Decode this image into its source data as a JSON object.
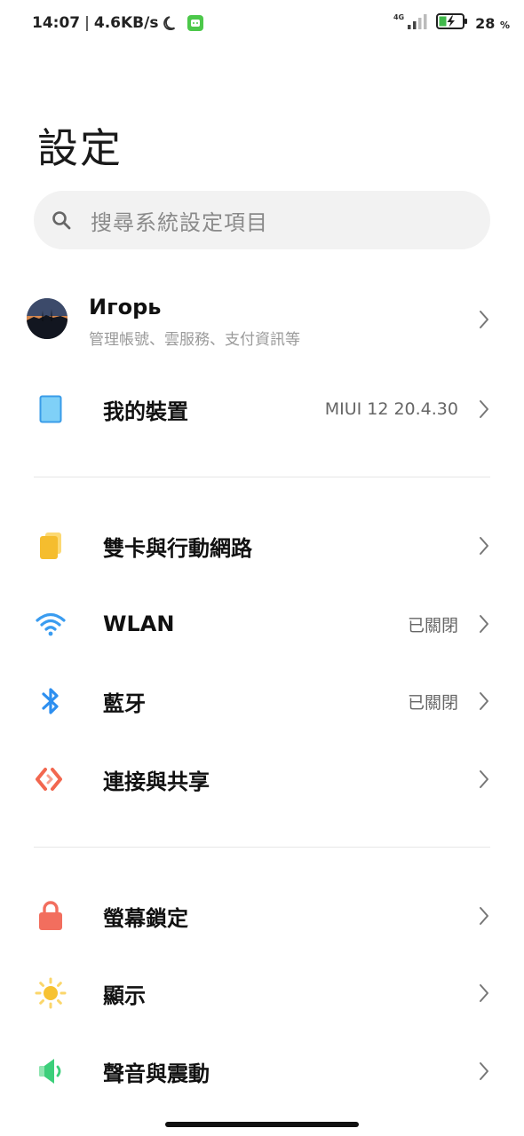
{
  "status_bar": {
    "time": "14:07",
    "separator": "|",
    "net_speed": "4.6KB/s",
    "network_type": "4G",
    "battery_level": "28",
    "battery_unit": "%",
    "moon_icon": "moon-icon",
    "app_icon": "android-notification-icon",
    "signal_icon": "signal-icon",
    "battery_icon": "battery-charging-icon"
  },
  "page": {
    "title": "設定"
  },
  "search": {
    "placeholder": "搜尋系統設定項目",
    "icon": "search-icon"
  },
  "account": {
    "name": "Игорь",
    "subtitle": "管理帳號、雲服務、支付資訊等"
  },
  "device": {
    "label": "我的裝置",
    "value": "MIUI 12 20.4.30",
    "icon": "tablet-icon"
  },
  "network_section": [
    {
      "label": "雙卡與行動網路",
      "value": "",
      "icon": "sim-card-icon",
      "color": "#f5bd2e"
    },
    {
      "label": "WLAN",
      "value": "已關閉",
      "icon": "wifi-icon",
      "color": "#3a9cf0"
    },
    {
      "label": "藍牙",
      "value": "已關閉",
      "icon": "bluetooth-icon",
      "color": "#2d8ff0"
    },
    {
      "label": "連接與共享",
      "value": "",
      "icon": "share-connection-icon",
      "color": "#f2674f"
    }
  ],
  "display_section": [
    {
      "label": "螢幕鎖定",
      "value": "",
      "icon": "lock-icon",
      "color": "#f26e5e"
    },
    {
      "label": "顯示",
      "value": "",
      "icon": "sun-icon",
      "color": "#f7c232"
    },
    {
      "label": "聲音與震動",
      "value": "",
      "icon": "speaker-icon",
      "color": "#3ccf7a"
    }
  ]
}
